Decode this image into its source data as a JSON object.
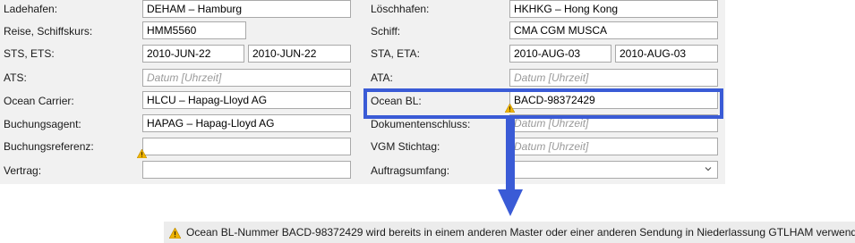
{
  "form": {
    "ladehafen": {
      "label": "Ladehafen:",
      "value": "DEHAM – Hamburg"
    },
    "loeschhafen": {
      "label": "Löschhafen:",
      "value": "HKHKG – Hong Kong"
    },
    "reise": {
      "label": "Reise, Schiffskurs:",
      "value": "HMM5560"
    },
    "schiff": {
      "label": "Schiff:",
      "value": "CMA CGM MUSCA"
    },
    "sts_ets": {
      "label": "STS, ETS:",
      "sts": "2010-JUN-22",
      "ets": "2010-JUN-22"
    },
    "sta_eta": {
      "label": "STA, ETA:",
      "sta": "2010-AUG-03",
      "eta": "2010-AUG-03"
    },
    "ats": {
      "label": "ATS:",
      "placeholder": "Datum [Uhrzeit]"
    },
    "ata": {
      "label": "ATA:",
      "placeholder": "Datum [Uhrzeit]"
    },
    "ocean_carrier": {
      "label": "Ocean Carrier:",
      "value": "HLCU – Hapag-Lloyd AG"
    },
    "ocean_bl": {
      "label": "Ocean BL:",
      "value": "BACD-98372429"
    },
    "buchungsagent": {
      "label": "Buchungsagent:",
      "value": "HAPAG – Hapag-Lloyd AG"
    },
    "dokumentenschluss": {
      "label": "Dokumentenschluss:",
      "placeholder": "Datum [Uhrzeit]"
    },
    "buchungsreferenz": {
      "label": "Buchungsreferenz:",
      "value": ""
    },
    "vgm_stichtag": {
      "label": "VGM Stichtag:",
      "placeholder": "Datum [Uhrzeit]"
    },
    "vertrag": {
      "label": "Vertrag:",
      "value": ""
    },
    "auftragsumfang": {
      "label": "Auftragsumfang:",
      "value": ""
    }
  },
  "status": {
    "message": "Ocean BL-Nummer BACD-98372429 wird bereits in einem anderen Master oder einer anderen Sendung in Niederlassung GTLHAM verwendet."
  },
  "colors": {
    "highlight": "#3a5bd6",
    "warning": "#f0b400",
    "panel": "#f1f1f1"
  },
  "icons": [
    "warning-icon",
    "chevron-down-icon"
  ]
}
